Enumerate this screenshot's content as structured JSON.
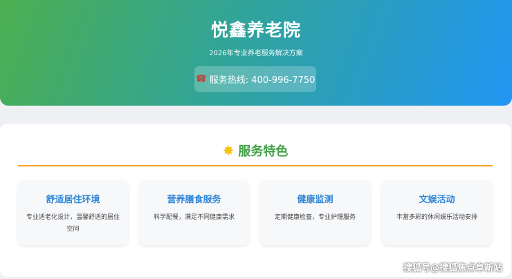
{
  "hero": {
    "title": "悦鑫养老院",
    "subtitle": "2026年专业养老服务解决方案",
    "hotline_icon": "phone-icon",
    "hotline": "服务热线: 400-996-7750"
  },
  "services": {
    "icon": "sparkle-burst-icon",
    "title": "服务特色",
    "items": [
      {
        "title": "舒适居住环境",
        "desc": "专业适老化设计，温馨舒适的居住空间"
      },
      {
        "title": "营养膳食服务",
        "desc": "科学配餐，满足不同健康需求"
      },
      {
        "title": "健康监测",
        "desc": "定期健康检查，专业护理服务"
      },
      {
        "title": "文娱活动",
        "desc": "丰富多彩的休闲娱乐活动安排"
      }
    ]
  },
  "watermark": "搜狐号@搜狐焦点阜新站",
  "colors": {
    "hero_gradient_start": "#4caf50",
    "hero_gradient_end": "#2196f3",
    "section_title": "#43a047",
    "divider": "#f5a623",
    "feature_title": "#2f86d8"
  }
}
